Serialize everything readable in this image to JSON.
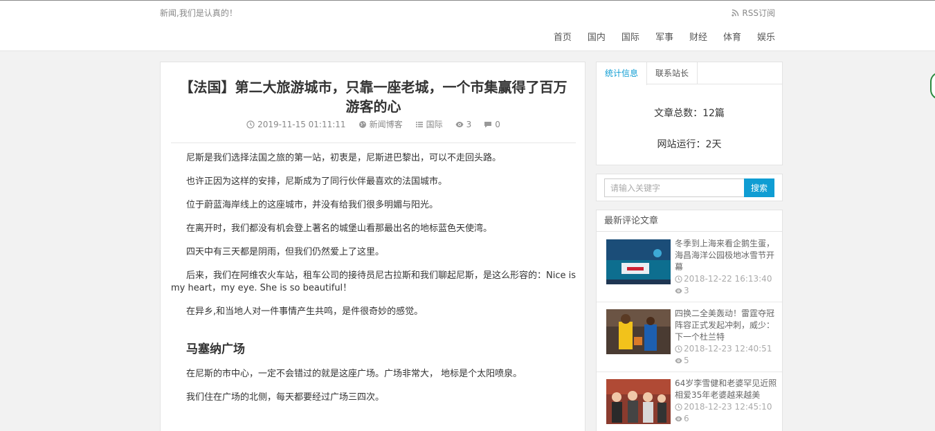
{
  "header": {
    "tagline": "新闻,我们是认真的！",
    "rss_label": "RSS订阅",
    "nav": [
      "首页",
      "国内",
      "国际",
      "军事",
      "财经",
      "体育",
      "娱乐"
    ]
  },
  "article": {
    "title": "【法国】第二大旅游城市，只靠一座老城，一个市集赢得了百万游客的心",
    "date": "2019-11-15 01:11:11",
    "author": "新闻博客",
    "category": "国际",
    "views": "3",
    "comments": "0",
    "paragraphs": [
      "尼斯是我们选择法国之旅的第一站，初衷是，尼斯进巴黎出，可以不走回头路。",
      "也许正因为这样的安排，尼斯成为了同行伙伴最喜欢的法国城市。",
      "位于蔚蓝海岸线上的这座城市，并没有给我们很多明媚与阳光。",
      "在离开时，我们都没有机会登上著名的城堡山看那最出名的地标蓝色天使湾。",
      "四天中有三天都是阴雨，但我们仍然爱上了这里。",
      "后来，我们在阿维农火车站，租车公司的接待员尼古拉斯和我们聊起尼斯，是这么形容的：Nice is my heart，my eye. She is so beautiful！",
      "在异乡,和当地人对一件事情产生共鸣，是件很奇妙的感觉。"
    ],
    "subheading": "马塞纳广场",
    "paragraphs2": [
      "在尼斯的市中心，一定不会错过的就是这座广场。广场非常大， 地标是个太阳喷泉。",
      "我们住在广场的北侧，每天都要经过广场三四次。"
    ]
  },
  "sidebar": {
    "tabs": [
      "统计信息",
      "联系站长"
    ],
    "stats": {
      "articles": "文章总数：12篇",
      "uptime": "网站运行：2天"
    },
    "search": {
      "placeholder": "请输入关键字",
      "button": "搜索"
    },
    "recent": {
      "heading": "最新评论文章",
      "posts": [
        {
          "title": "冬季到上海来看企鹅生蛋，海昌海洋公园极地冰雪节开幕",
          "date": "2018-12-22 16:13:40",
          "views": "3"
        },
        {
          "title": "四换二全美轰动！雷霆夺冠阵容正式发起冲刺，威少：下一个杜兰特",
          "date": "2018-12-23 12:40:51",
          "views": "5"
        },
        {
          "title": "64岁李雪健和老婆罕见近照 相爱35年老婆越来越美",
          "date": "2018-12-23 12:45:10",
          "views": "6"
        }
      ]
    }
  }
}
